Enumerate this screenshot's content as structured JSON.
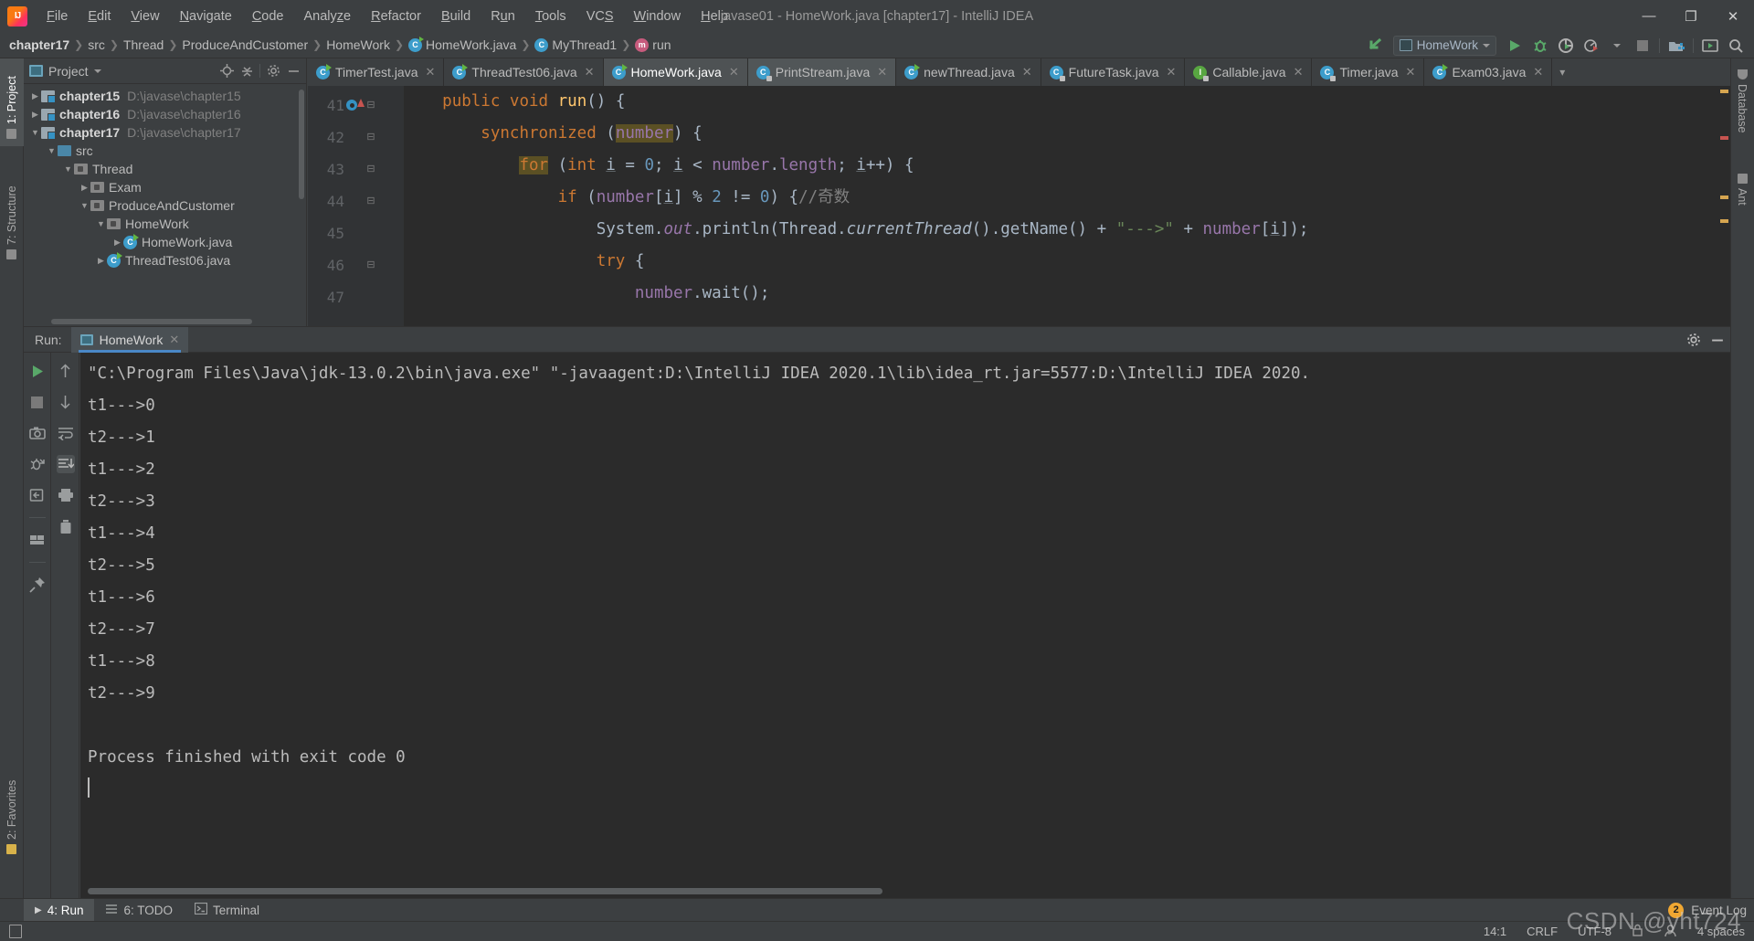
{
  "window": {
    "title": "javase01 - HomeWork.java [chapter17] - IntelliJ IDEA",
    "minimize": "—",
    "maximize": "❐",
    "close": "✕",
    "logo": "intellij-idea-logo"
  },
  "menubar": [
    {
      "label": "File",
      "mnemonic": "F"
    },
    {
      "label": "Edit",
      "mnemonic": "E"
    },
    {
      "label": "View",
      "mnemonic": "V"
    },
    {
      "label": "Navigate",
      "mnemonic": "N"
    },
    {
      "label": "Code",
      "mnemonic": "C"
    },
    {
      "label": "Analyze",
      "mnemonic": "z"
    },
    {
      "label": "Refactor",
      "mnemonic": "R"
    },
    {
      "label": "Build",
      "mnemonic": "B"
    },
    {
      "label": "Run",
      "mnemonic": "u"
    },
    {
      "label": "Tools",
      "mnemonic": "T"
    },
    {
      "label": "VCS",
      "mnemonic": "S"
    },
    {
      "label": "Window",
      "mnemonic": "W"
    },
    {
      "label": "Help",
      "mnemonic": "H"
    }
  ],
  "breadcrumb": [
    {
      "label": "chapter17",
      "icon": "none",
      "bold": true
    },
    {
      "label": "src",
      "icon": "none",
      "bold": false
    },
    {
      "label": "Thread",
      "icon": "none",
      "bold": false
    },
    {
      "label": "ProduceAndCustomer",
      "icon": "none",
      "bold": false
    },
    {
      "label": "HomeWork",
      "icon": "none",
      "bold": false
    },
    {
      "label": "HomeWork.java",
      "icon": "class-icon",
      "bold": false
    },
    {
      "label": "MyThread1",
      "icon": "class-icon",
      "bold": false
    },
    {
      "label": "run",
      "icon": "method-icon",
      "bold": false
    }
  ],
  "toolbar": {
    "back_icon": "back-arrow-icon",
    "run_config": "HomeWork",
    "run_icon": "run-icon",
    "debug_icon": "debug-icon",
    "coverage_icon": "run-with-coverage-icon",
    "profiler_icon": "profiler-icon",
    "stop_icon": "stop-icon",
    "project_structure_icon": "project-structure-icon",
    "updates_icon": "update-icon",
    "search_icon": "search-everywhere-icon"
  },
  "left_strip": [
    {
      "label": "1: Project",
      "num": "1",
      "active": true
    },
    {
      "label": "7: Structure",
      "num": "7",
      "active": false
    },
    {
      "label": "2: Favorites",
      "num": "2",
      "active": false
    }
  ],
  "right_strip": [
    {
      "label": "Database"
    },
    {
      "label": "Ant"
    }
  ],
  "project_panel": {
    "title": "Project",
    "locate_icon": "locate-icon",
    "collapse_icon": "collapse-all-icon",
    "settings_icon": "gear-icon",
    "hide_icon": "hide-icon",
    "tree": [
      {
        "indent": 0,
        "arrow": "▶",
        "icon": "module",
        "label": "chapter15",
        "bold": true,
        "path": "D:\\javase\\chapter15"
      },
      {
        "indent": 0,
        "arrow": "▶",
        "icon": "module",
        "label": "chapter16",
        "bold": true,
        "path": "D:\\javase\\chapter16"
      },
      {
        "indent": 0,
        "arrow": "▼",
        "icon": "module",
        "label": "chapter17",
        "bold": true,
        "path": "D:\\javase\\chapter17"
      },
      {
        "indent": 1,
        "arrow": "▼",
        "icon": "source-folder",
        "label": "src",
        "bold": false,
        "path": ""
      },
      {
        "indent": 2,
        "arrow": "▼",
        "icon": "package",
        "label": "Thread",
        "bold": false,
        "path": ""
      },
      {
        "indent": 3,
        "arrow": "▶",
        "icon": "package",
        "label": "Exam",
        "bold": false,
        "path": ""
      },
      {
        "indent": 3,
        "arrow": "▼",
        "icon": "package",
        "label": "ProduceAndCustomer",
        "bold": false,
        "path": ""
      },
      {
        "indent": 4,
        "arrow": "▼",
        "icon": "package",
        "label": "HomeWork",
        "bold": false,
        "path": ""
      },
      {
        "indent": 5,
        "arrow": "▶",
        "icon": "java-runnable",
        "label": "HomeWork.java",
        "bold": false,
        "path": ""
      },
      {
        "indent": 4,
        "arrow": "▶",
        "icon": "java-runnable",
        "label": "ThreadTest06.java",
        "bold": false,
        "path": ""
      }
    ]
  },
  "editor_tabs": [
    {
      "label": "TimerTest.java",
      "icon": "java-runnable",
      "state": "normal"
    },
    {
      "label": "ThreadTest06.java",
      "icon": "java-runnable",
      "state": "normal"
    },
    {
      "label": "HomeWork.java",
      "icon": "java-runnable",
      "state": "active"
    },
    {
      "label": "PrintStream.java",
      "icon": "java-readonly",
      "state": "selected"
    },
    {
      "label": "newThread.java",
      "icon": "java-runnable",
      "state": "normal"
    },
    {
      "label": "FutureTask.java",
      "icon": "java-readonly",
      "state": "normal"
    },
    {
      "label": "Callable.java",
      "icon": "interface-readonly",
      "state": "normal"
    },
    {
      "label": "Timer.java",
      "icon": "java-readonly",
      "state": "normal"
    },
    {
      "label": "Exam03.java",
      "icon": "java-runnable",
      "state": "normal"
    }
  ],
  "editor": {
    "lines": [
      {
        "num": "41",
        "fold": "⊟",
        "gutter": "breakpoint-run"
      },
      {
        "num": "42",
        "fold": "⊟",
        "gutter": ""
      },
      {
        "num": "43",
        "fold": "⊟",
        "gutter": ""
      },
      {
        "num": "44",
        "fold": "⊟",
        "gutter": ""
      },
      {
        "num": "45",
        "fold": "",
        "gutter": ""
      },
      {
        "num": "46",
        "fold": "⊟",
        "gutter": ""
      },
      {
        "num": "47",
        "fold": "",
        "gutter": ""
      }
    ],
    "code_text": [
      "    public void run() {",
      "        synchronized (number) {",
      "            for (int i = 0; i < number.length; i++) {",
      "                if (number[i] % 2 != 0) {//奇数",
      "                    System.out.println(Thread.currentThread().getName() + \"--->\" + number[i]);",
      "                    try {",
      "                        number.wait();"
    ]
  },
  "run_window": {
    "label": "Run:",
    "tab": "HomeWork",
    "tab_close": "✕",
    "settings_icon": "gear-icon",
    "hide_icon": "hide-icon",
    "toolbar_left": [
      "rerun-icon",
      "stop-icon",
      "screenshot-icon",
      "dump-threads-icon",
      "restore-layout-icon",
      "layout-icon",
      "pin-icon"
    ],
    "toolbar_right": [
      "up-icon",
      "down-icon",
      "soft-wrap-icon",
      "scroll-to-end-icon",
      "print-icon",
      "trash-icon"
    ],
    "console": [
      "\"C:\\Program Files\\Java\\jdk-13.0.2\\bin\\java.exe\" \"-javaagent:D:\\IntelliJ IDEA 2020.1\\lib\\idea_rt.jar=5577:D:\\IntelliJ IDEA 2020.",
      "t1--->0",
      "t2--->1",
      "t1--->2",
      "t2--->3",
      "t1--->4",
      "t2--->5",
      "t1--->6",
      "t2--->7",
      "t1--->8",
      "t2--->9",
      "",
      "Process finished with exit code 0"
    ]
  },
  "bottom_bar": [
    {
      "label": "4: Run",
      "num": "4",
      "icon": "run-icon",
      "active": true
    },
    {
      "label": "6: TODO",
      "num": "6",
      "icon": "todo-icon",
      "active": false
    },
    {
      "label": "Terminal",
      "num": "",
      "icon": "terminal-icon",
      "active": false
    }
  ],
  "bottom_right": {
    "event_count": "2",
    "event_log": "Event Log"
  },
  "statusbar": {
    "position": "14:1",
    "line_separator": "CRLF",
    "encoding": "UTF-8",
    "indent": "4 spaces",
    "lock_icon": "lock-icon",
    "inspector_icon": "inspection-icon"
  },
  "watermark": "CSDN @yht724",
  "colors": {
    "accent_blue": "#4a88c7",
    "run_green": "#59a869",
    "keyword_orange": "#cc7832",
    "string_green": "#6a8759",
    "field_purple": "#9876aa",
    "number_blue": "#6897bb",
    "method_yellow": "#ffc66d",
    "editor_bg": "#2b2b2b",
    "panel_bg": "#3c3f41"
  }
}
